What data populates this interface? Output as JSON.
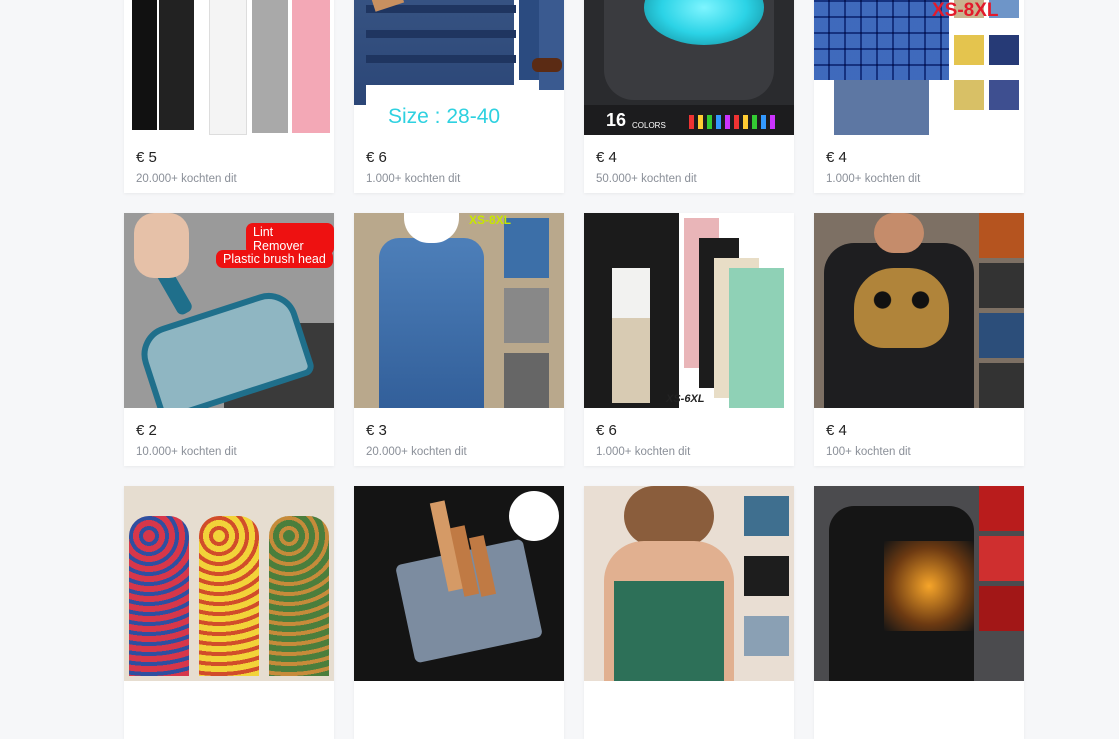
{
  "products": [
    {
      "price": "€ 5",
      "sold": "20.000+ kochten dit",
      "image": "palazzo-pants"
    },
    {
      "price": "€ 6",
      "sold": "1.000+ kochten dit",
      "image": "denim-jeans",
      "overlay": "Size : 28-40"
    },
    {
      "price": "€ 4",
      "sold": "50.000+ kochten dit",
      "image": "toilet-night-light",
      "overlay": "16",
      "overlay2": "COLORS"
    },
    {
      "price": "€ 4",
      "sold": "1.000+ kochten dit",
      "image": "plaid-shirts",
      "overlay": "XS-8XL"
    },
    {
      "price": "€ 2",
      "sold": "10.000+ kochten dit",
      "image": "lint-remover",
      "overlay": "Lint Remover",
      "overlay2": "Plastic brush head"
    },
    {
      "price": "€ 3",
      "sold": "20.000+ kochten dit",
      "image": "denim-dress",
      "overlay": "XS-8XL"
    },
    {
      "price": "€ 6",
      "sold": "1.000+ kochten dit",
      "image": "linen-pants",
      "overlay": "XS-6XL"
    },
    {
      "price": "€ 4",
      "sold": "100+ kochten dit",
      "image": "skull-tshirt"
    },
    {
      "image": "floral-dresses"
    },
    {
      "image": "cigarette-lighter-case"
    },
    {
      "image": "camisole-tops"
    },
    {
      "image": "eagle-shirt"
    }
  ],
  "colors": {
    "accent_red": "#e11",
    "page_bg": "#f6f7f9"
  }
}
